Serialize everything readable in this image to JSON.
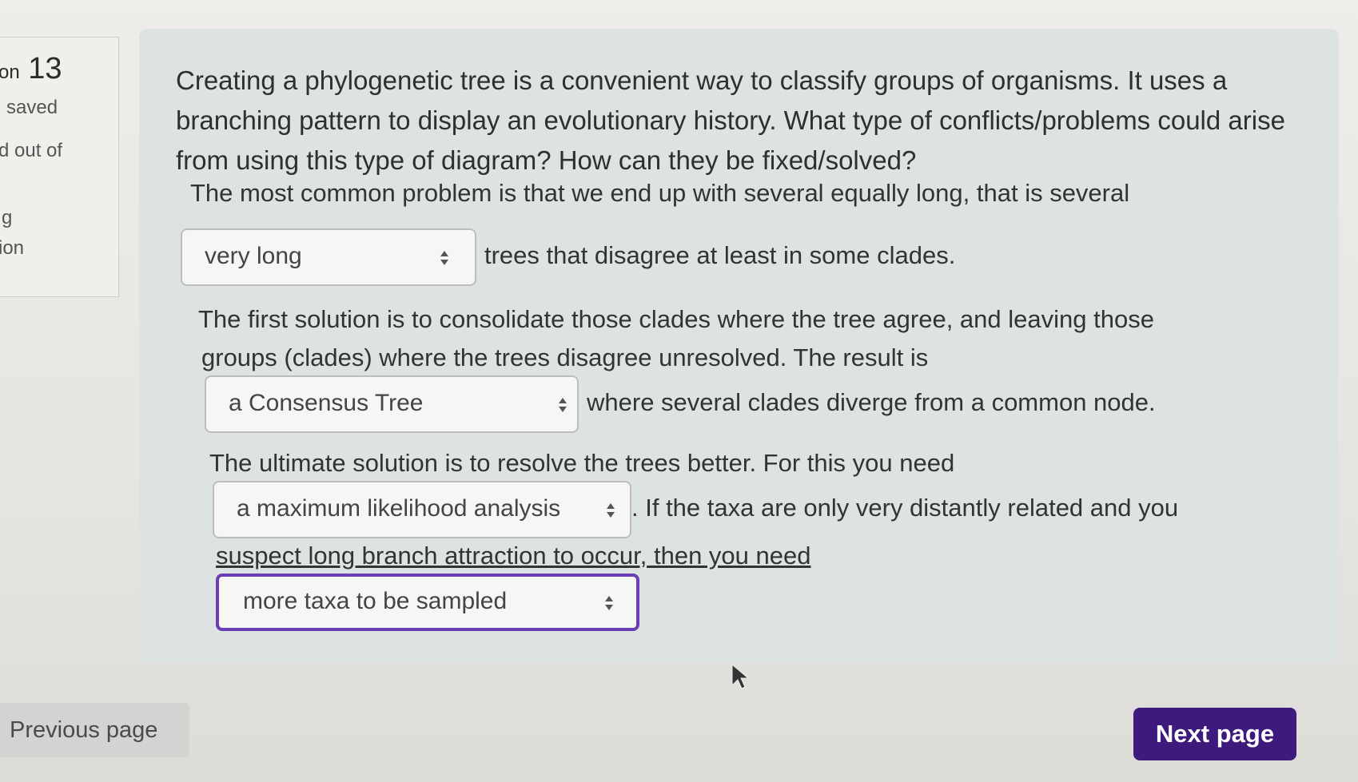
{
  "question_info": {
    "number_label": "on",
    "number": "13",
    "status": "saved",
    "marks": "d out of",
    "flag_line1": "g",
    "flag_line2": "ion"
  },
  "question": {
    "prompt": "Creating a phylogenetic tree is a convenient way to classify groups of organisms. It uses a branching pattern to display an evolutionary history. What type of conflicts/problems could arise from using this type of diagram? How can they be fixed/solved?",
    "para1_before": "The most common problem is that we end up with several equally long, that is several",
    "select1_value": "very long",
    "para1_after": "trees that disagree at least in some clades.",
    "para2_line1": "The first solution is to consolidate those clades where the tree agree, and leaving those",
    "para2_line2": "groups (clades) where the trees disagree unresolved. The result is",
    "select2_value": "a Consensus Tree",
    "para2_after": "where several clades diverge from a common node.",
    "para3_line1": "The ultimate solution is to resolve the trees better. For this you need",
    "select3_value": "a maximum likelihood analysis",
    "para3_after": ". If the taxa are only very distantly related and you",
    "para3_line3": "suspect long branch attraction to occur, then you need",
    "select4_value": "more taxa to be sampled"
  },
  "navigation": {
    "previous_label": "Previous page",
    "next_label": "Next page"
  },
  "colors": {
    "next_button": "#3e1a7c",
    "focus_border": "#6b3fb4",
    "panel_bg": "#dce3e2"
  },
  "icons": {
    "select_arrow": "select-arrows-icon",
    "cursor": "mouse-pointer-icon"
  }
}
